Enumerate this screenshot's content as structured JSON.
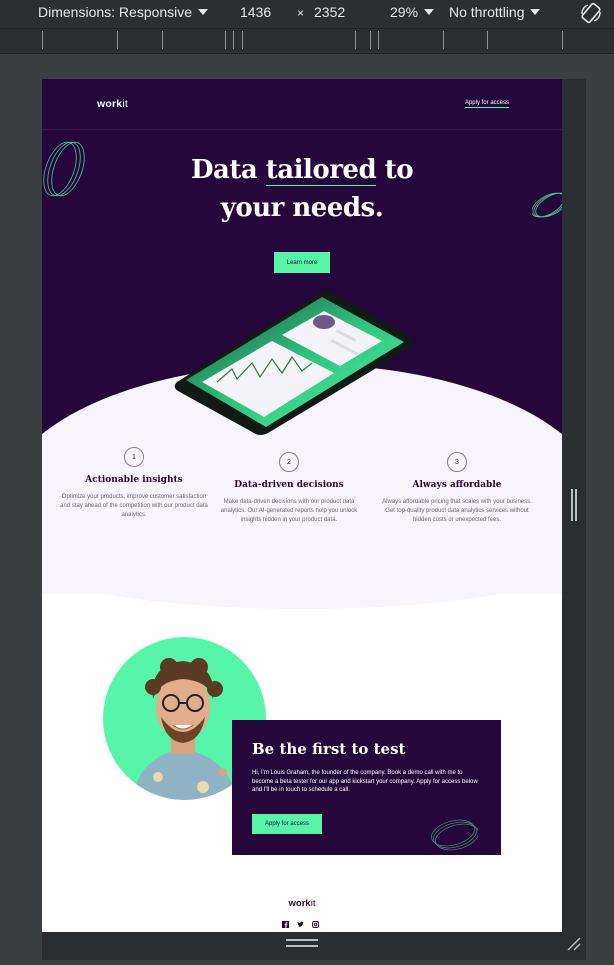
{
  "devtools": {
    "dimensions_label": "Dimensions: Responsive",
    "width": "1436",
    "times": "×",
    "height": "2352",
    "zoom": "29%",
    "throttling": "No throttling"
  },
  "page": {
    "logo_main": "work",
    "logo_suffix": "it",
    "nav_link": "Apply for access",
    "hero_title_line1_a": "Data ",
    "hero_title_line1_b": "tailored",
    "hero_title_line1_c": " to",
    "hero_title_line2": "your needs.",
    "learn_more": "Learn more",
    "features": [
      {
        "num": "1",
        "title": "Actionable insights",
        "desc": "Optimize your products, improve customer satisfaction and stay ahead of the competition with our product data analytics."
      },
      {
        "num": "2",
        "title": "Data-driven decisions",
        "desc": "Make data-driven decisions with our product data analytics. Our AI-generated reports help you unlock insights hidden in your product data."
      },
      {
        "num": "3",
        "title": "Always affordable",
        "desc": "Always affordable pricing that scales with your business. Get top-quality product data analytics services without hidden costs or unexpected fees."
      }
    ],
    "card": {
      "title": "Be the first to test",
      "text": "Hi, I'm Louis Graham, the founder of the company. Book a demo call with me to become a beta tester for our app and kickstart your company. Apply for access below and I'll be in touch to schedule a call.",
      "button": "Apply for access"
    },
    "footer_logo_main": "work",
    "footer_logo_suffix": "it",
    "social_icons": [
      "facebook-icon",
      "twitter-icon",
      "instagram-icon"
    ]
  },
  "colors": {
    "purple": "#26073c",
    "green": "#56f5a7",
    "light": "#f7f4fd"
  }
}
